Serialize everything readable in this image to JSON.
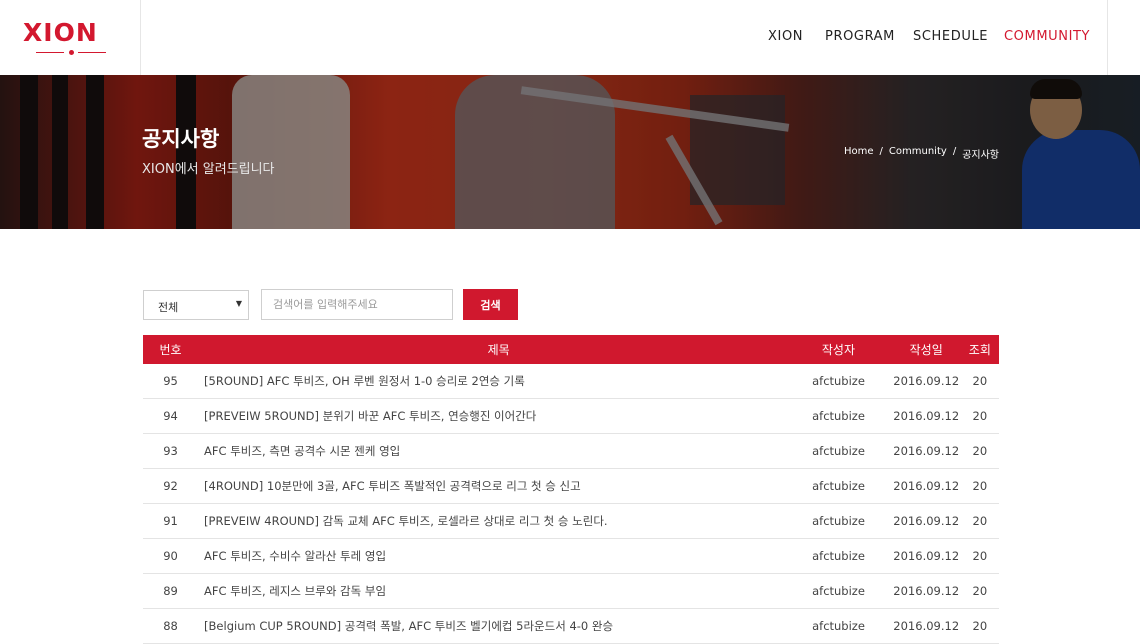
{
  "header": {
    "logo": "XION",
    "nav": [
      {
        "label": "XION",
        "active": false
      },
      {
        "label": "PROGRAM",
        "active": false
      },
      {
        "label": "SCHEDULE",
        "active": false
      },
      {
        "label": "COMMUNITY",
        "active": true
      }
    ]
  },
  "hero": {
    "title": "공지사항",
    "subtitle": "XION에서 알려드립니다",
    "breadcrumb": [
      "Home",
      "/",
      "Community",
      "/",
      "공지사항"
    ]
  },
  "search": {
    "select_value": "전체",
    "input_placeholder": "검색어를 입력해주세요",
    "button_label": "검색"
  },
  "table": {
    "headers": {
      "no": "번호",
      "title": "제목",
      "author": "작성자",
      "date": "작성일",
      "views": "조회"
    },
    "rows": [
      {
        "no": "95",
        "title": "[5ROUND] AFC 투비즈, OH 루벤 원정서 1-0 승리로 2연승 기록",
        "author": "afctubize",
        "date": "2016.09.12",
        "views": "20"
      },
      {
        "no": "94",
        "title": "[PREVEIW 5ROUND] 분위기 바꾼 AFC 투비즈, 연승행진 이어간다",
        "author": "afctubize",
        "date": "2016.09.12",
        "views": "20"
      },
      {
        "no": "93",
        "title": "AFC 투비즈, 측면 공격수 시몬 젠케 영입",
        "author": "afctubize",
        "date": "2016.09.12",
        "views": "20"
      },
      {
        "no": "92",
        "title": "[4ROUND] 10분만에 3골, AFC 투비즈 폭발적인 공격력으로 리그 첫 승 신고",
        "author": "afctubize",
        "date": "2016.09.12",
        "views": "20"
      },
      {
        "no": "91",
        "title": "[PREVEIW 4ROUND] 감독 교체 AFC 투비즈, 로셀라르 상대로 리그 첫 승 노린다.",
        "author": "afctubize",
        "date": "2016.09.12",
        "views": "20"
      },
      {
        "no": "90",
        "title": "AFC 투비즈, 수비수 알라산 투레 영입",
        "author": "afctubize",
        "date": "2016.09.12",
        "views": "20"
      },
      {
        "no": "89",
        "title": "AFC 투비즈, 레지스 브루와 감독 부임",
        "author": "afctubize",
        "date": "2016.09.12",
        "views": "20"
      },
      {
        "no": "88",
        "title": "[Belgium CUP 5ROUND] 공격력 폭발, AFC 투비즈 벨기에컵 5라운드서 4-0 완승",
        "author": "afctubize",
        "date": "2016.09.12",
        "views": "20"
      }
    ]
  },
  "colors": {
    "accent": "#d0182e",
    "nav_text": "#222222"
  }
}
